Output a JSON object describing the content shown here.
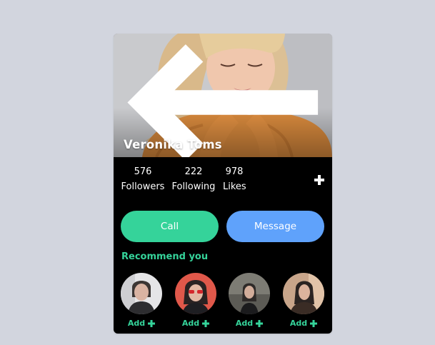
{
  "profile": {
    "name": "Veronika Toms"
  },
  "stats": {
    "followers": {
      "count": "576",
      "label": "Followers"
    },
    "following": {
      "count": "222",
      "label": "Following"
    },
    "likes": {
      "count": "978",
      "label": "Likes"
    }
  },
  "actions": {
    "call_label": "Call",
    "message_label": "Message"
  },
  "recommendations": {
    "title": "Recommend you",
    "items": [
      {
        "add_label": "Add"
      },
      {
        "add_label": "Add"
      },
      {
        "add_label": "Add"
      },
      {
        "add_label": "Add"
      }
    ]
  },
  "colors": {
    "accent_green": "#35d39a",
    "accent_blue": "#5fa2fb",
    "card_background": "#000000",
    "page_background": "#d2d5de"
  },
  "icons": {
    "back": "arrow-left-icon",
    "add": "plus-icon"
  }
}
